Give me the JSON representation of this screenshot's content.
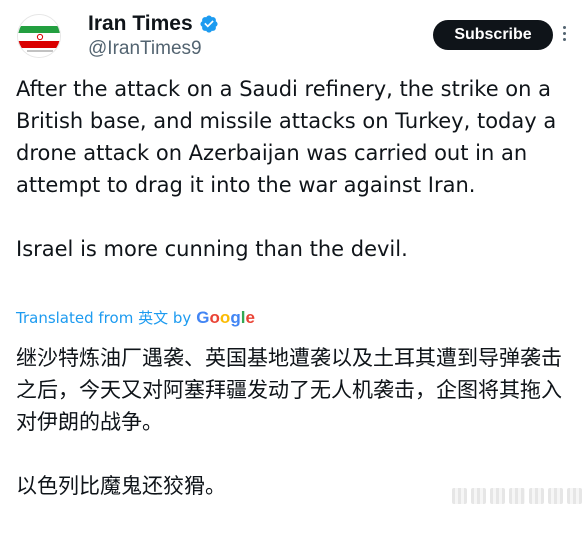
{
  "author": {
    "name": "Iran Times",
    "handle": "@IranTimes9",
    "avatar_icon": "iran-flag-avatar",
    "verified_icon": "verified-badge-icon",
    "verified_color": "#1d9bf0"
  },
  "header": {
    "subscribe_label": "Subscribe",
    "more_icon": "more-vertical-icon"
  },
  "tweet": {
    "paragraph1": "After the attack on a Saudi refinery, the strike on a British base, and missile attacks on Turkey, today a drone attack on Azerbaijan was carried out in an attempt to drag it into the war against Iran.",
    "paragraph2": "Israel is more cunning than the devil."
  },
  "translation": {
    "label_prefix": "Translated from",
    "language": "英文",
    "by": "by",
    "provider": "Google",
    "paragraph1": "继沙特炼油厂遇袭、英国基地遭袭以及土耳其遭到导弹袭击之后，今天又对阿塞拜疆发动了无人机袭击，企图将其拖入对伊朗的战争。",
    "paragraph2": "以色列比魔鬼还狡猾。",
    "link_color": "#1d9bf0"
  },
  "colors": {
    "text": "#0f1419",
    "secondary": "#536471",
    "button_bg": "#0f1419"
  }
}
